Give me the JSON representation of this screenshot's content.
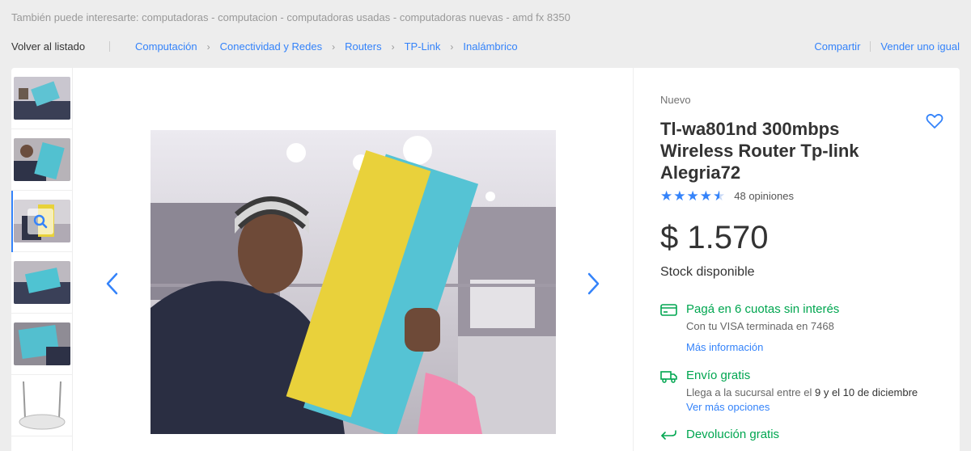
{
  "related": {
    "text": "También puede interesarte: computadoras - computacion - computadoras usadas - computadoras nuevas - amd fx 8350"
  },
  "nav": {
    "back_label": "Volver al listado",
    "breadcrumbs": [
      "Computación",
      "Conectividad y Redes",
      "Routers",
      "TP-Link",
      "Inalámbrico"
    ],
    "share_label": "Compartir",
    "sell_label": "Vender uno igual"
  },
  "gallery": {
    "thumbnails": [
      {
        "name": "thumb-1"
      },
      {
        "name": "thumb-2"
      },
      {
        "name": "thumb-3",
        "active": true
      },
      {
        "name": "thumb-4"
      },
      {
        "name": "thumb-5"
      },
      {
        "name": "thumb-6"
      }
    ],
    "prev_icon": "chevron-left-icon",
    "next_icon": "chevron-right-icon"
  },
  "product": {
    "condition": "Nuevo",
    "title": "Tl-wa801nd 300mbps Wireless Router Tp-link Alegria72",
    "rating": 4.5,
    "reviews": "48 opiniones",
    "price": "$ 1.570",
    "stock": "Stock disponible"
  },
  "payment": {
    "title": "Pagá en 6 cuotas sin interés",
    "subtitle": "Con tu VISA terminada en 7468",
    "link": "Más información"
  },
  "shipping": {
    "title": "Envío gratis",
    "subtitle_pre": "Llega a la sucursal entre el ",
    "subtitle_date1": "9 y el 10 de diciembre",
    "link": "Ver más opciones"
  },
  "returns": {
    "title": "Devolución gratis"
  },
  "colors": {
    "accent": "#3483fa",
    "green": "#00a650",
    "background": "#ededed"
  }
}
